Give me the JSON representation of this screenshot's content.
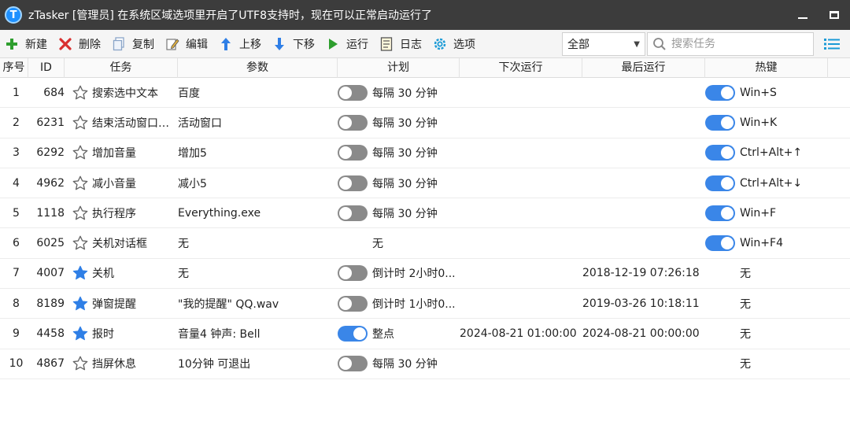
{
  "window": {
    "logo_letter": "T",
    "title": "zTasker [管理员]   在系统区域选项里开启了UTF8支持时，现在可以正常启动运行了"
  },
  "toolbar": {
    "new": "新建",
    "delete": "删除",
    "copy": "复制",
    "edit": "编辑",
    "move_up": "上移",
    "move_down": "下移",
    "run": "运行",
    "log": "日志",
    "options": "选项"
  },
  "filter": {
    "selected": "全部"
  },
  "search": {
    "placeholder": "搜索任务"
  },
  "columns": {
    "seq": "序号",
    "id": "ID",
    "task": "任务",
    "param": "参数",
    "plan": "计划",
    "next_run": "下次运行",
    "last_run": "最后运行",
    "hotkey": "热键"
  },
  "rows": [
    {
      "seq": "1",
      "id": "684",
      "starred": false,
      "task": "搜索选中文本",
      "param": "百度",
      "plan_toggle": "off",
      "plan": "每隔 30 分钟",
      "next_run": "",
      "last_run": "",
      "hotkey_toggle": "on",
      "hotkey": "Win+S"
    },
    {
      "seq": "2",
      "id": "6231",
      "starred": false,
      "task": "结束活动窗口及...",
      "param": "活动窗口",
      "plan_toggle": "off",
      "plan": "每隔 30 分钟",
      "next_run": "",
      "last_run": "",
      "hotkey_toggle": "on",
      "hotkey": "Win+K"
    },
    {
      "seq": "3",
      "id": "6292",
      "starred": false,
      "task": "增加音量",
      "param": "增加5",
      "plan_toggle": "off",
      "plan": "每隔 30 分钟",
      "next_run": "",
      "last_run": "",
      "hotkey_toggle": "on",
      "hotkey": "Ctrl+Alt+↑"
    },
    {
      "seq": "4",
      "id": "4962",
      "starred": false,
      "task": "减小音量",
      "param": "减小5",
      "plan_toggle": "off",
      "plan": "每隔 30 分钟",
      "next_run": "",
      "last_run": "",
      "hotkey_toggle": "on",
      "hotkey": "Ctrl+Alt+↓"
    },
    {
      "seq": "5",
      "id": "1118",
      "starred": false,
      "task": "执行程序",
      "param": "Everything.exe",
      "plan_toggle": "off",
      "plan": "每隔 30 分钟",
      "next_run": "",
      "last_run": "",
      "hotkey_toggle": "on",
      "hotkey": "Win+F"
    },
    {
      "seq": "6",
      "id": "6025",
      "starred": false,
      "task": "关机对话框",
      "param": "无",
      "plan_toggle": "none",
      "plan": "无",
      "next_run": "",
      "last_run": "",
      "hotkey_toggle": "on",
      "hotkey": "Win+F4"
    },
    {
      "seq": "7",
      "id": "4007",
      "starred": true,
      "task": "关机",
      "param": "无",
      "plan_toggle": "off",
      "plan": "倒计时 2小时0...",
      "next_run": "",
      "last_run": "2018-12-19 07:26:18",
      "hotkey_toggle": "none",
      "hotkey": "无"
    },
    {
      "seq": "8",
      "id": "8189",
      "starred": true,
      "task": "弹窗提醒",
      "param": "\"我的提醒\" QQ.wav",
      "plan_toggle": "off",
      "plan": "倒计时 1小时0...",
      "next_run": "",
      "last_run": "2019-03-26 10:18:11",
      "hotkey_toggle": "none",
      "hotkey": "无"
    },
    {
      "seq": "9",
      "id": "4458",
      "starred": true,
      "task": "报时",
      "param": "音量4 钟声: Bell",
      "plan_toggle": "on",
      "plan": "整点",
      "next_run": "2024-08-21 01:00:00",
      "last_run": "2024-08-21 00:00:00",
      "hotkey_toggle": "none",
      "hotkey": "无"
    },
    {
      "seq": "10",
      "id": "4867",
      "starred": false,
      "task": "挡屏休息",
      "param": "10分钟 可退出",
      "plan_toggle": "off",
      "plan": "每隔 30 分钟",
      "next_run": "",
      "last_run": "",
      "hotkey_toggle": "none",
      "hotkey": "无"
    }
  ],
  "colors": {
    "toggle_on": "#3a86e8",
    "toggle_off": "#8a8a8a",
    "star_filled": "#2f7fe6",
    "title_bar": "#3c3c3c"
  }
}
